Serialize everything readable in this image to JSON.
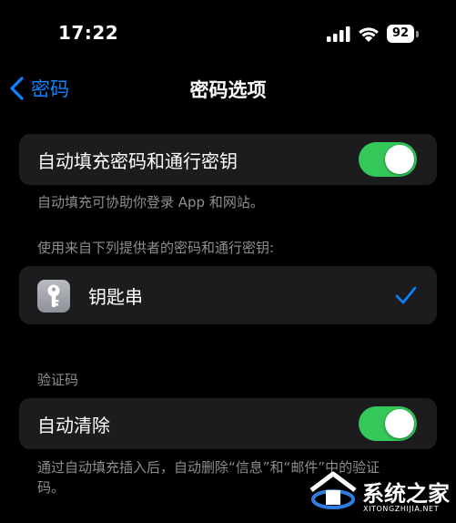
{
  "status_bar": {
    "time": "17:22",
    "battery_level": "92",
    "icons": [
      "cellular-signal-icon",
      "wifi-icon",
      "battery-icon"
    ]
  },
  "nav": {
    "back_label": "密码",
    "title": "密码选项"
  },
  "autofill": {
    "label": "自动填充密码和通行密钥",
    "enabled": true,
    "footnote": "自动填充可协助你登录 App 和网站。"
  },
  "providers": {
    "header": "使用来自下列提供者的密码和通行密钥:",
    "items": [
      {
        "label": "钥匙串",
        "icon": "keychain-icon",
        "selected": true
      }
    ]
  },
  "verification": {
    "header": "验证码",
    "label": "自动清除",
    "enabled": true,
    "footnote": "通过自动填充插入后，自动删除“信息”和“邮件”中的验证码。"
  },
  "watermark": {
    "brand": "系统之家",
    "url": "XITONGZHIJIA.NET"
  },
  "colors": {
    "background": "#000000",
    "cell": "#1c1c1e",
    "accent": "#0a84ff",
    "toggle_on": "#34c759",
    "secondary_text": "#8e8e93"
  }
}
